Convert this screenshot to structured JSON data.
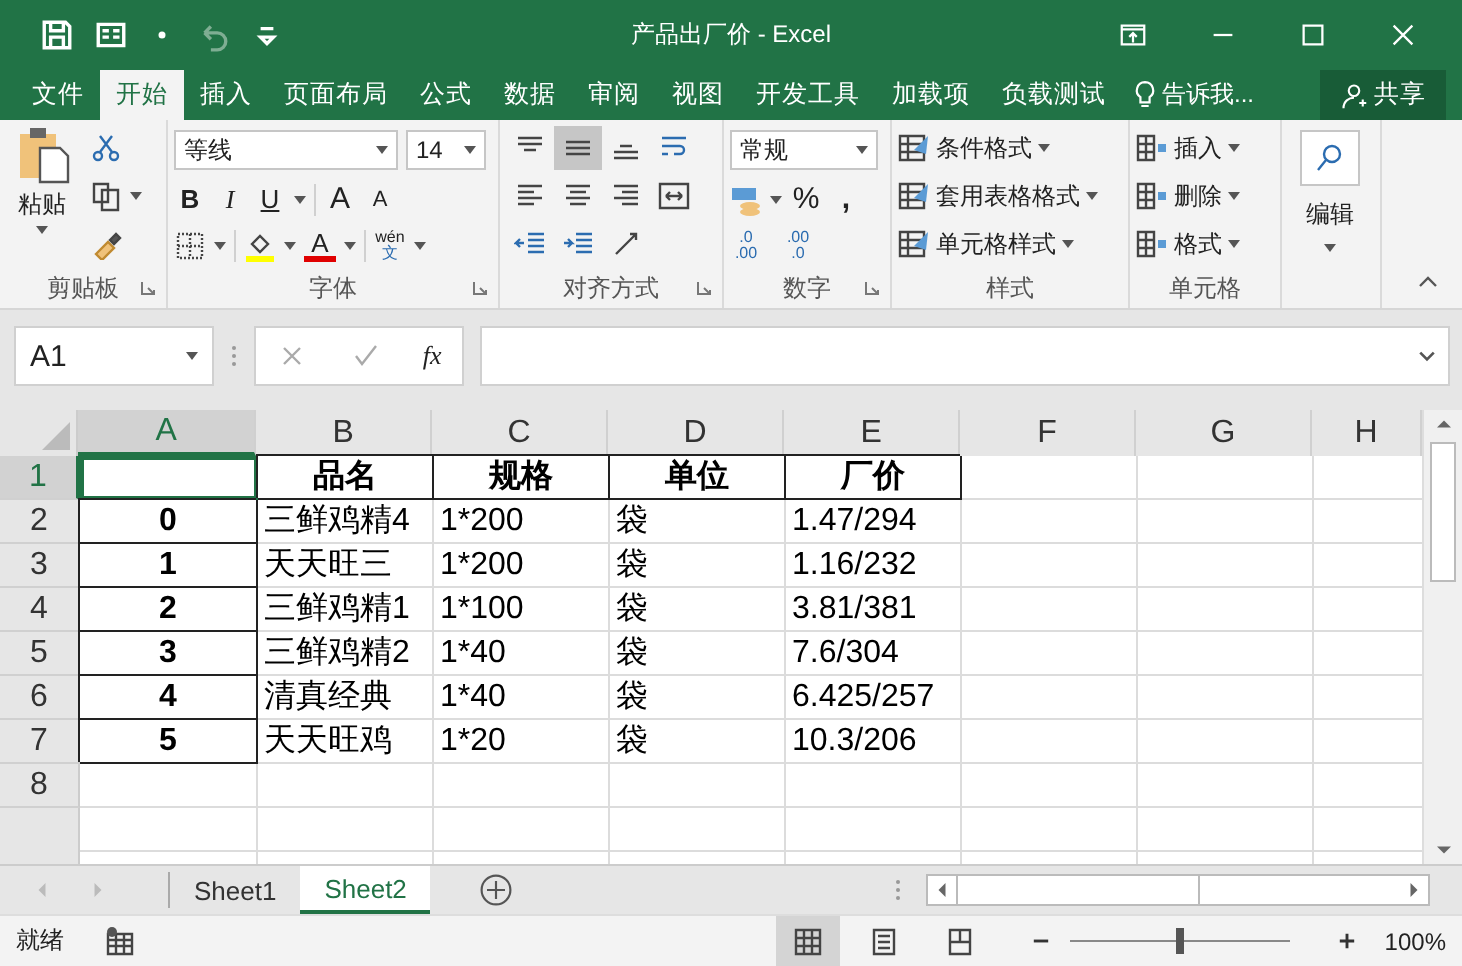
{
  "window": {
    "title": "产品出厂价 - Excel"
  },
  "quick_access": [
    {
      "kind": "save",
      "disabled": false
    },
    {
      "kind": "form",
      "disabled": false
    },
    {
      "kind": "dot",
      "disabled": false
    },
    {
      "kind": "undo",
      "disabled": true
    },
    {
      "kind": "customize",
      "disabled": false
    }
  ],
  "ribbon_tabs": [
    {
      "label": "文件",
      "selected": false
    },
    {
      "label": "开始",
      "selected": true
    },
    {
      "label": "插入",
      "selected": false
    },
    {
      "label": "页面布局",
      "selected": false
    },
    {
      "label": "公式",
      "selected": false
    },
    {
      "label": "数据",
      "selected": false
    },
    {
      "label": "审阅",
      "selected": false
    },
    {
      "label": "视图",
      "selected": false
    },
    {
      "label": "开发工具",
      "selected": false
    },
    {
      "label": "加载项",
      "selected": false
    },
    {
      "label": "负载测试",
      "selected": false
    }
  ],
  "tell_me": "告诉我...",
  "share_button": "共享",
  "ribbon": {
    "clipboard": {
      "label": "剪贴板",
      "paste": "粘贴"
    },
    "font": {
      "label": "字体",
      "font_name": "等线",
      "font_size": "14",
      "bold": "B",
      "italic": "I",
      "underline": "U",
      "grow": "A",
      "shrink": "A",
      "font_color": "A",
      "phonetic_top": "wén",
      "phonetic_bottom": "文"
    },
    "alignment": {
      "label": "对齐方式",
      "buttons": [
        {
          "kind": "top",
          "selected": false
        },
        {
          "kind": "middle",
          "selected": true
        },
        {
          "kind": "bottom",
          "selected": false
        },
        {
          "kind": "wrap",
          "selected": false
        },
        {
          "kind": "left",
          "selected": false
        },
        {
          "kind": "center",
          "selected": false
        },
        {
          "kind": "right",
          "selected": false
        },
        {
          "kind": "merge",
          "selected": false
        },
        {
          "kind": "outdent",
          "selected": false
        },
        {
          "kind": "indent",
          "selected": false
        },
        {
          "kind": "orientation",
          "selected": false
        }
      ]
    },
    "number": {
      "label": "数字",
      "format": "常规",
      "percent": "%",
      "comma": ",",
      "decimals": [
        {
          "top": ".0",
          "bottom": ".00"
        },
        {
          "top": ".00",
          "bottom": ".0"
        }
      ]
    },
    "styles": {
      "label": "样式",
      "items": [
        "条件格式",
        "套用表格格式",
        "单元格样式"
      ]
    },
    "cells": {
      "label": "单元格",
      "items": [
        "插入",
        "删除",
        "格式"
      ]
    },
    "editing": {
      "label": "编辑"
    }
  },
  "name_box": "A1",
  "formula_bar": {
    "function_label": "fx"
  },
  "columns": [
    {
      "label": "A",
      "selected": true
    },
    {
      "label": "B",
      "selected": false
    },
    {
      "label": "C",
      "selected": false
    },
    {
      "label": "D",
      "selected": false
    },
    {
      "label": "E",
      "selected": false
    },
    {
      "label": "F",
      "selected": false
    },
    {
      "label": "G",
      "selected": false
    },
    {
      "label": "H",
      "selected": false
    }
  ],
  "rows": [
    {
      "number": "1",
      "selected": true,
      "cells": [
        null,
        "品名",
        "规格",
        "单位",
        "厂价"
      ]
    },
    {
      "number": "2",
      "selected": false,
      "cells": [
        "0",
        "三鲜鸡精4",
        "1*200",
        "袋",
        "1.47/294"
      ]
    },
    {
      "number": "3",
      "selected": false,
      "cells": [
        "1",
        "天天旺三",
        "1*200",
        "袋",
        "1.16/232"
      ]
    },
    {
      "number": "4",
      "selected": false,
      "cells": [
        "2",
        "三鲜鸡精1",
        "1*100",
        "袋",
        "3.81/381"
      ]
    },
    {
      "number": "5",
      "selected": false,
      "cells": [
        "3",
        "三鲜鸡精2",
        "1*40",
        "袋",
        "7.6/304"
      ]
    },
    {
      "number": "6",
      "selected": false,
      "cells": [
        "4",
        "清真经典",
        "1*40",
        "袋",
        "6.425/257"
      ]
    },
    {
      "number": "7",
      "selected": false,
      "cells": [
        "5",
        "天天旺鸡",
        "1*20",
        "袋",
        "10.3/206"
      ]
    },
    {
      "number": "8",
      "selected": false
    }
  ],
  "sheets": [
    {
      "label": "Sheet1",
      "selected": false
    },
    {
      "label": "Sheet2",
      "selected": true
    }
  ],
  "status_bar": {
    "text": "就绪",
    "views": [
      {
        "kind": "normal",
        "selected": true
      },
      {
        "kind": "page-layout",
        "selected": false
      },
      {
        "kind": "page-break",
        "selected": false
      }
    ],
    "zoom": {
      "level": 0.5,
      "reading": "100%"
    }
  }
}
